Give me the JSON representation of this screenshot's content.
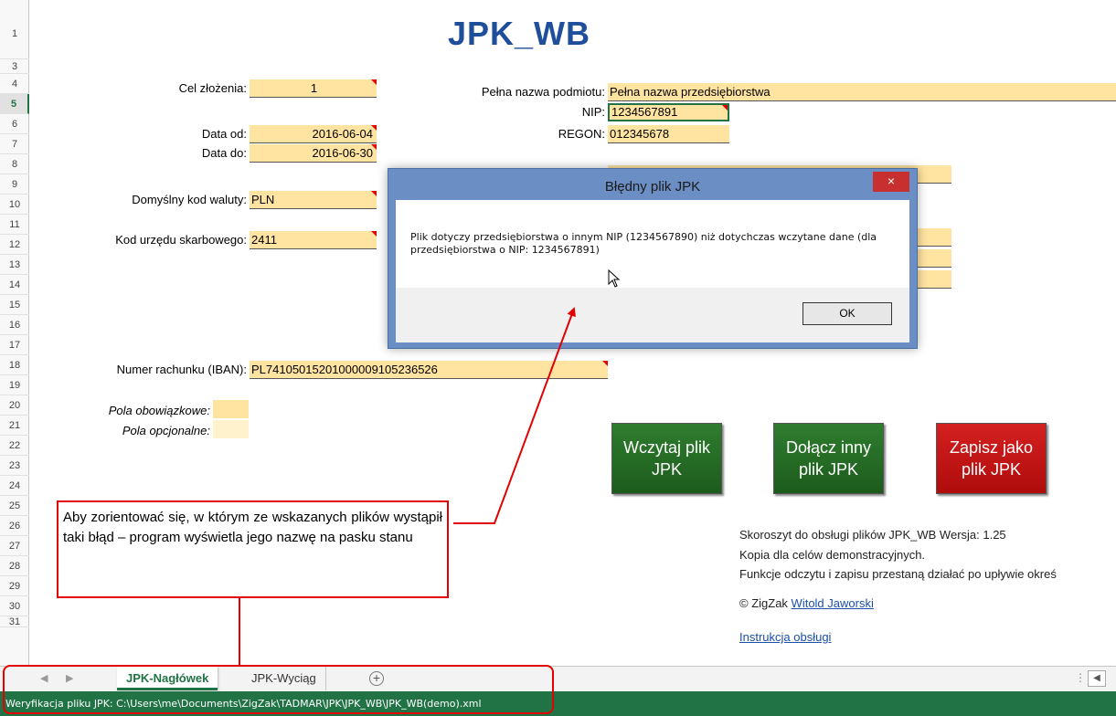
{
  "sheet": {
    "title": "JPK_WB",
    "rows": [
      "1",
      "3",
      "4",
      "5",
      "6",
      "7",
      "8",
      "9",
      "10",
      "11",
      "12",
      "13",
      "14",
      "15",
      "16",
      "17",
      "18",
      "19",
      "20",
      "21",
      "22",
      "23",
      "24",
      "25",
      "26",
      "27",
      "28",
      "29",
      "30",
      "31"
    ],
    "active_row": "5",
    "fields": {
      "cel_label": "Cel złożenia:",
      "cel_value": "1",
      "data_od_label": "Data od:",
      "data_od_value": "2016-06-04",
      "data_do_label": "Data do:",
      "data_do_value": "2016-06-30",
      "waluta_label": "Domyślny kod waluty:",
      "waluta_value": "PLN",
      "urzad_label": "Kod urzędu skarbowego:",
      "urzad_value": "2411",
      "iban_label": "Numer rachunku (IBAN):",
      "iban_value": "PL74105015201000009105236526",
      "nazwa_label": "Pełna nazwa podmiotu:",
      "nazwa_value": "Pełna nazwa przedsiębiorstwa",
      "nip_label": "NIP:",
      "nip_value": "1234567891",
      "regon_label": "REGON:",
      "regon_value": "012345678"
    },
    "legend": {
      "required_label": "Pola obowiązkowe:",
      "optional_label": "Pola opcjonalne:"
    },
    "buttons": {
      "load": "Wczytaj plik JPK",
      "append": "Dołącz inny plik JPK",
      "save": "Zapisz jako plik JPK"
    },
    "info": {
      "line1": "Skoroszyt do obsługi plików JPK_WB    Wersja: 1.25",
      "line2": "Kopia dla celów demonstracyjnych.",
      "line3": "Funkcje odczytu i zapisu przestaną działać po upływie okreś",
      "copyright_prefix": "© ZigZak ",
      "author_link": "Witold Jaworski",
      "manual_link": "Instrukcja obsługi"
    }
  },
  "dialog": {
    "title": "Błędny plik JPK",
    "close_label": "×",
    "message": "Plik dotyczy przedsiębiorstwa o innym NIP (1234567890) niż dotychczas wczytane dane (dla przedsiębiorstwa o NIP: 1234567891)",
    "ok_label": "OK"
  },
  "annotation": {
    "text": "Aby zorientować się, w którym ze wskazanych plików wystąpił taki błąd – program wyświetla jego nazwę na pasku stanu"
  },
  "tabs": {
    "active": "JPK-Nagłówek",
    "second": "JPK-Wyciąg",
    "add": "+"
  },
  "statusbar": {
    "text": "Weryfikacja pliku JPK: C:\\Users\\me\\Documents\\ZigZak\\TADMAR\\JPK\\JPK_WB\\JPK_WB(demo).xml"
  },
  "colors": {
    "required": "#ffe3a0",
    "optional": "#fff2cc",
    "excel_green": "#217346",
    "title_blue": "#1f4e9a",
    "annotation_red": "#e30000"
  }
}
